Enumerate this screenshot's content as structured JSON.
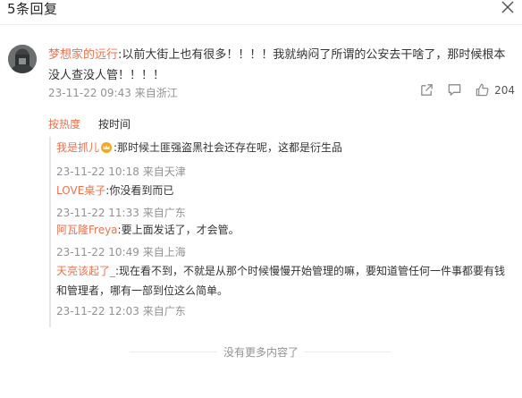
{
  "header": {
    "title": "5条回复"
  },
  "main_comment": {
    "username": "梦想家的远行",
    "text": ":以前大街上也有很多！！！！我就纳闷了所谓的公安去干啥了，那时候根本没人查没人管！！！！",
    "timestamp": "23-11-22 09:43",
    "location": "来自浙江",
    "like_count": "204"
  },
  "sort_tabs": [
    "按热度",
    "按时间"
  ],
  "replies": [
    {
      "username": "我是抓儿",
      "text": ":那时候土匪强盗黑社会还存在呢，这都是衍生品",
      "timestamp": "23-11-22 10:18",
      "location": "来自天津"
    },
    {
      "username": "LOVE桌子",
      "text": ":你没看到而已",
      "timestamp": "23-11-22 11:33",
      "location": "来自广东"
    },
    {
      "username": "阿瓦隆Freya",
      "text": ":要上面发话了，才会管。",
      "timestamp": "23-11-22 10:49",
      "location": "来自上海"
    },
    {
      "username": "天亮该起了_",
      "text": ":现在看不到，不就是从那个时候慢慢开始管理的嘛，要知道管任何一件事都要有钱和管理者，哪有一部到位这么简单。",
      "timestamp": "23-11-22 12:03",
      "location": "来自广东"
    }
  ],
  "footer": {
    "no_more_text": "没有更多内容了"
  },
  "colors": {
    "accent": "#eb7350",
    "meta": "#939393",
    "text": "#333333"
  },
  "icons": [
    "close-icon",
    "share-icon",
    "comment-icon",
    "like-icon",
    "crown-icon"
  ]
}
